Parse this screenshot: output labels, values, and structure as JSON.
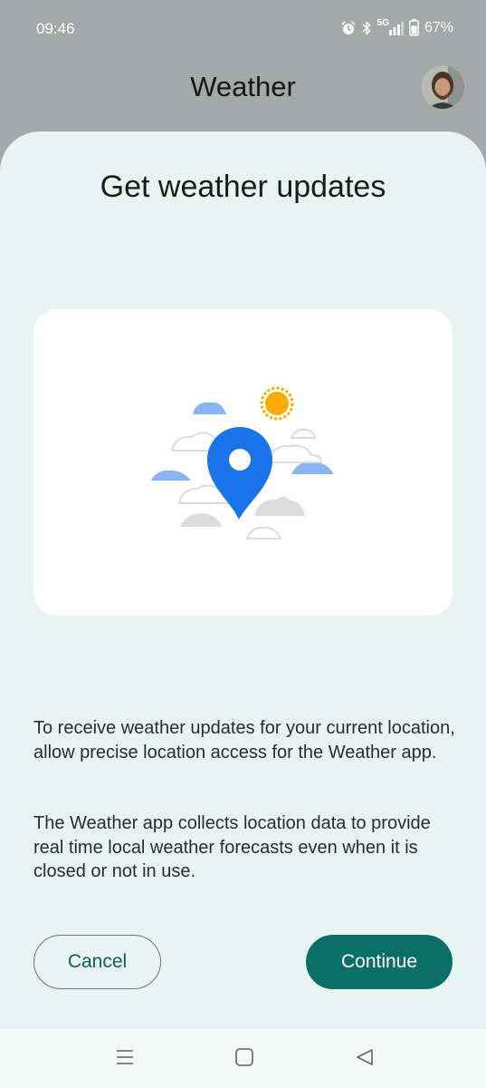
{
  "status_bar": {
    "time": "09:46",
    "network": "5G",
    "battery": "67%"
  },
  "header": {
    "title": "Weather"
  },
  "dialog": {
    "title": "Get weather updates",
    "paragraph1": "To receive weather updates for your current location, allow precise location access for the Weather app.",
    "paragraph2": "The Weather app collects location data to provide real time local weather forecasts even when it is closed or not in use.",
    "cancel_label": "Cancel",
    "continue_label": "Continue"
  },
  "colors": {
    "sheet_bg": "#e7f4f2",
    "accent": "#0b6e67",
    "pin": "#1a73e8",
    "sun": "#f9ab00",
    "cloud_blue": "#8ab4f8",
    "cloud_grey": "#dadce0"
  },
  "icons": {
    "alarm": "alarm-icon",
    "bluetooth": "bluetooth-icon",
    "signal": "signal-icon",
    "battery": "battery-icon",
    "nav_recents": "recents-icon",
    "nav_home": "home-icon",
    "nav_back": "back-icon"
  }
}
